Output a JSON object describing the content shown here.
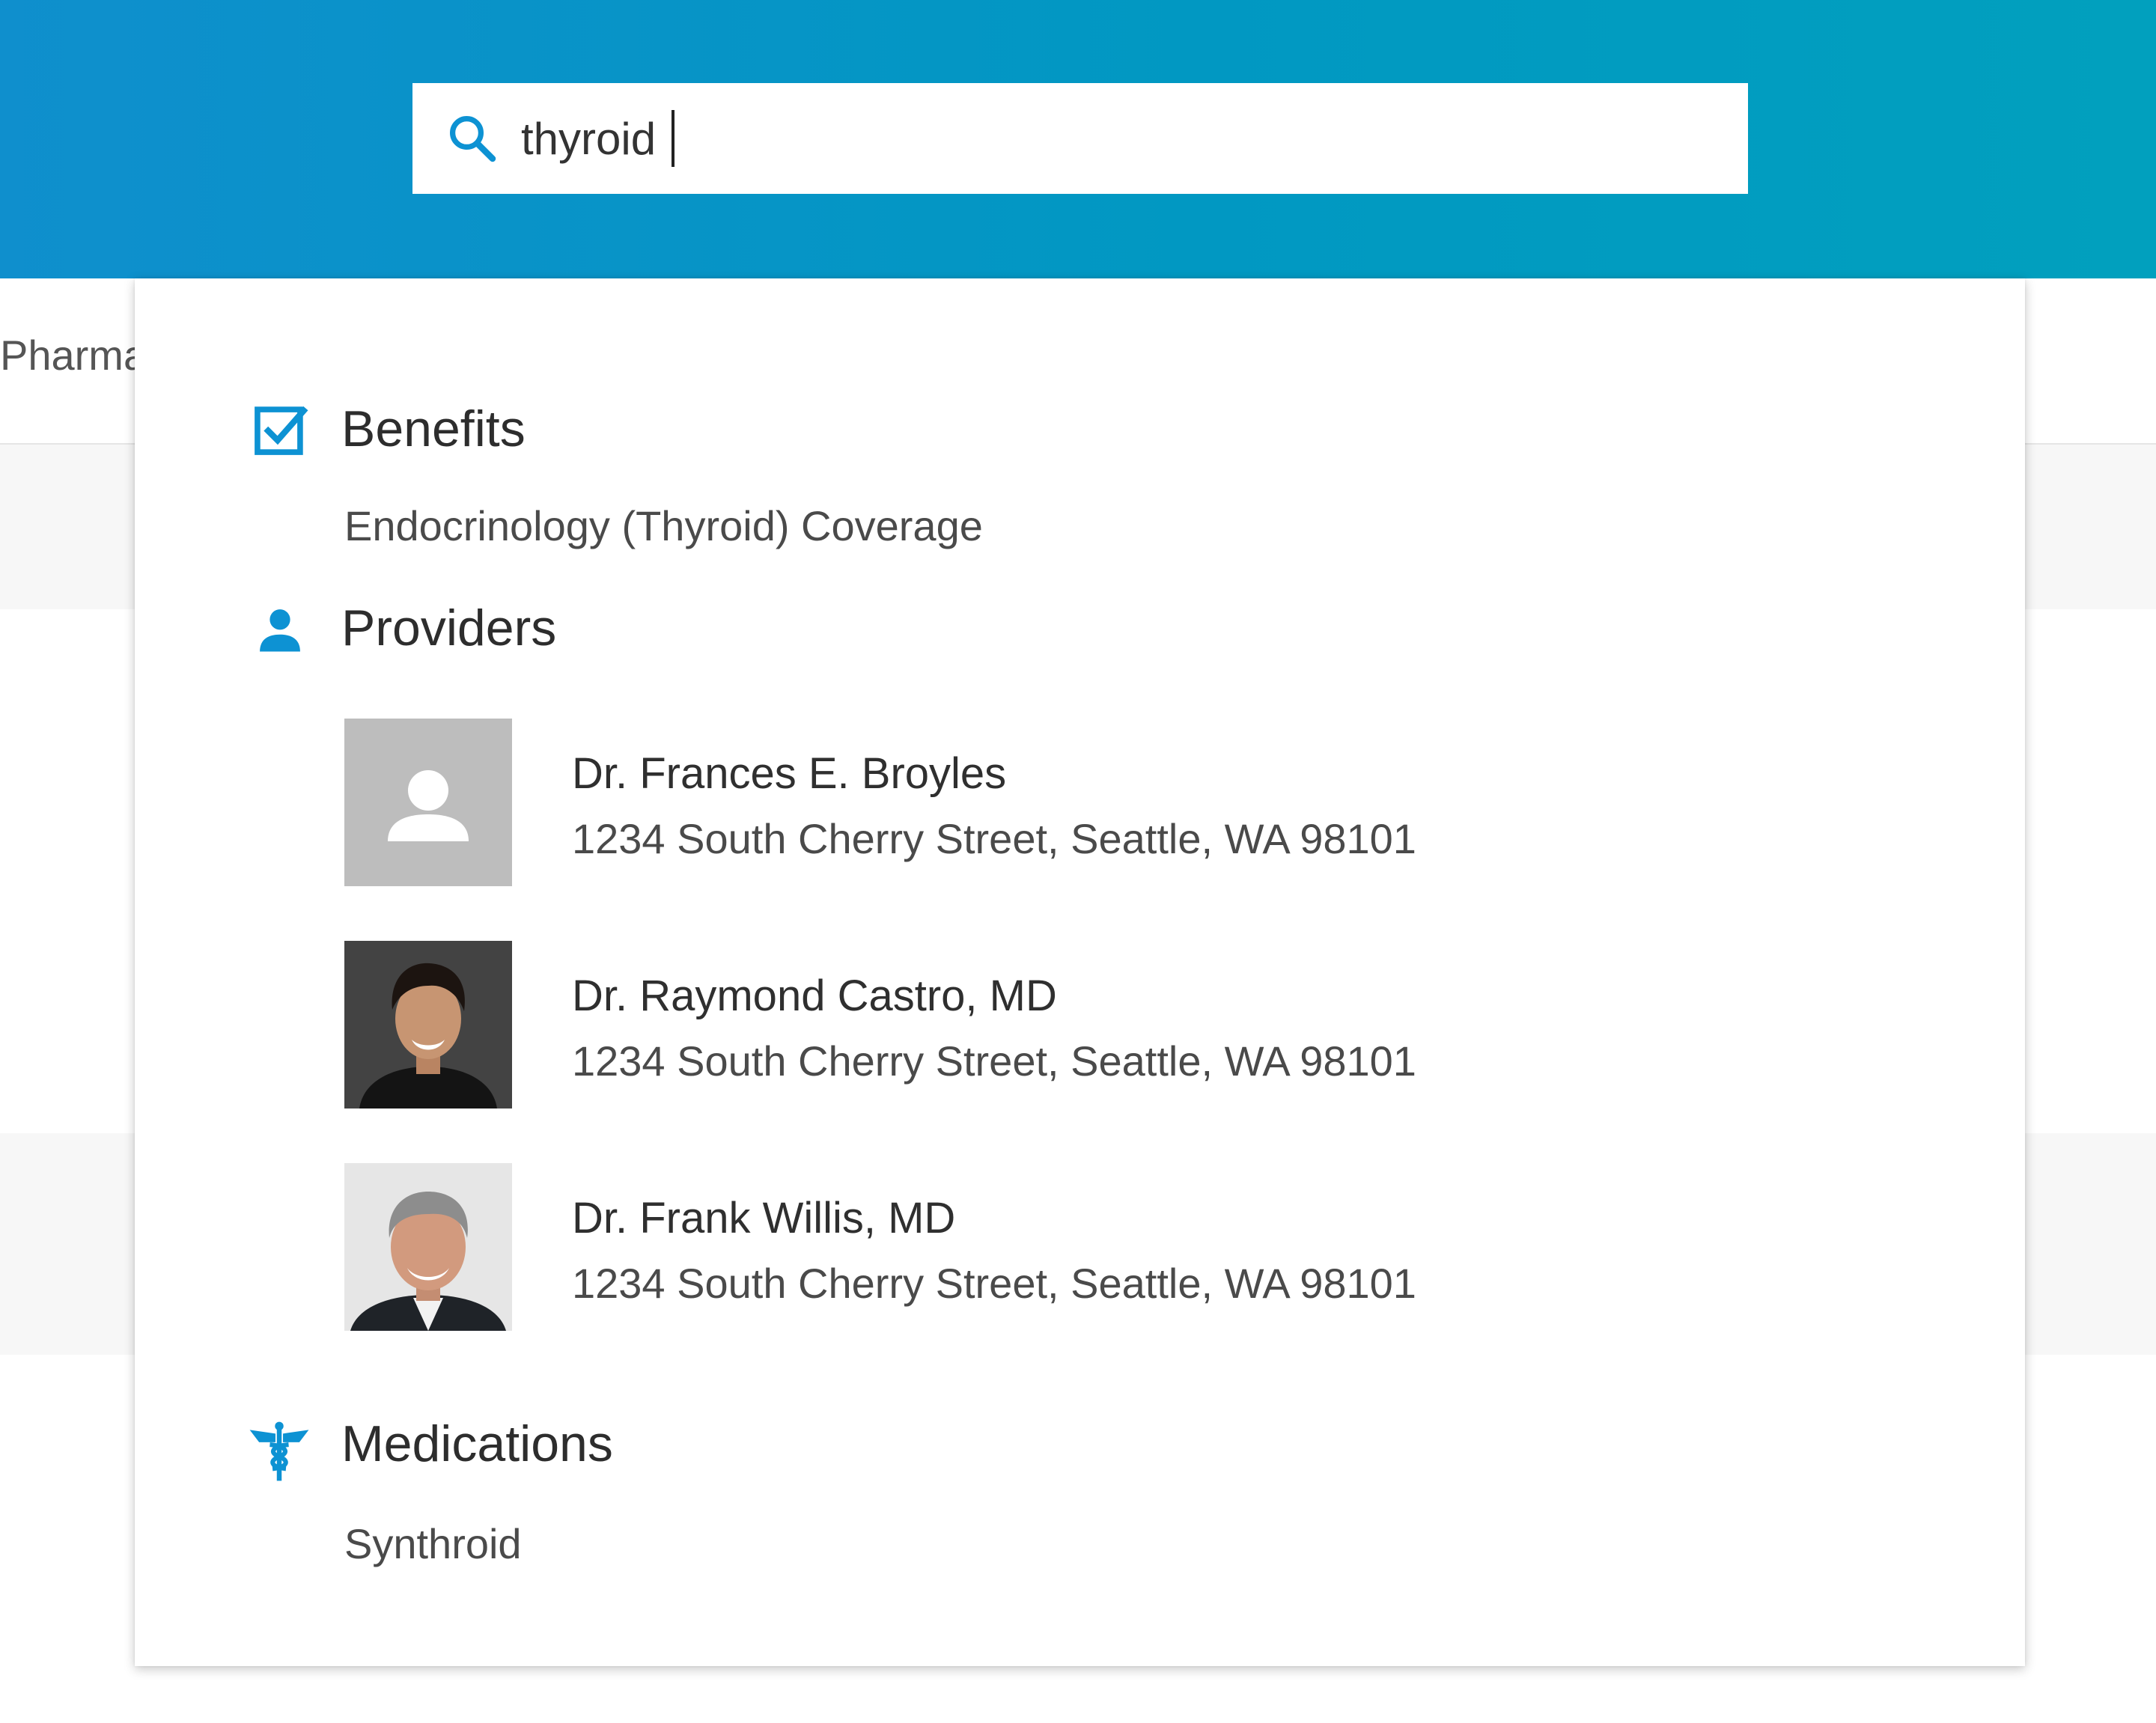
{
  "search": {
    "query": "thyroid",
    "icon": "search-icon"
  },
  "background": {
    "tab_label": "Pharma"
  },
  "colors": {
    "accent": "#0d92d3",
    "header_start": "#0f8fcd",
    "header_end": "#01a0be"
  },
  "results": {
    "benefits": {
      "title": "Benefits",
      "icon": "checkbox-checked-icon",
      "items": [
        "Endocrinology (Thyroid) Coverage"
      ]
    },
    "providers": {
      "title": "Providers",
      "icon": "person-icon",
      "items": [
        {
          "name": "Dr. Frances E. Broyles",
          "address": "1234 South Cherry Street, Seattle, WA 98101",
          "avatar": "placeholder-avatar-icon"
        },
        {
          "name": "Dr. Raymond Castro, MD",
          "address": "1234 South Cherry Street, Seattle, WA 98101",
          "avatar": "photo-avatar"
        },
        {
          "name": "Dr. Frank Willis, MD",
          "address": "1234 South Cherry Street, Seattle, WA 98101",
          "avatar": "photo-avatar"
        }
      ]
    },
    "medications": {
      "title": "Medications",
      "icon": "caduceus-icon",
      "items": [
        "Synthroid"
      ]
    }
  }
}
